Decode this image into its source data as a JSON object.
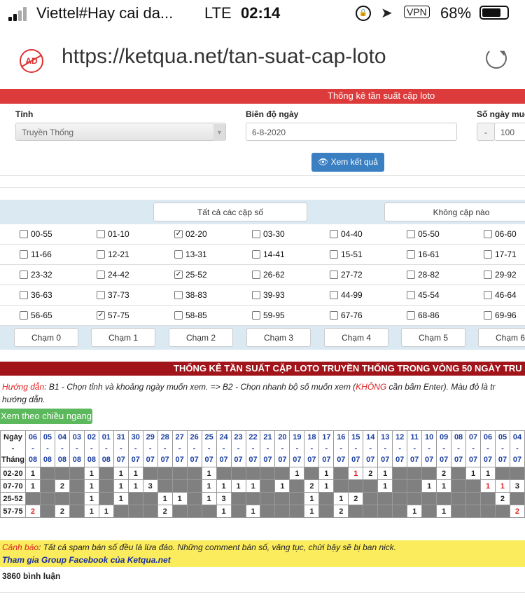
{
  "status_bar": {
    "carrier": "Viettel#Hay cai da...",
    "network": "LTE",
    "time": "02:14",
    "vpn": "VPN",
    "battery": "68%"
  },
  "browser": {
    "ad_badge": "AD",
    "url": "https://ketqua.net/tan-suat-cap-loto"
  },
  "form": {
    "header": "Thống kê tần suất cặp loto",
    "province_label": "Tỉnh",
    "province_value": "Truyền Thống",
    "range_label": "Biên độ ngày",
    "range_value": "6-8-2020",
    "days_label": "Số ngày muốn",
    "days_minus": "-",
    "days_value": "100",
    "submit_label": "Xem kết quả"
  },
  "pairs": {
    "all_label": "Tất cả các cặp số",
    "none_label": "Không cặp nào",
    "rows": [
      [
        {
          "label": "00-55",
          "checked": false
        },
        {
          "label": "01-10",
          "checked": false
        },
        {
          "label": "02-20",
          "checked": true
        },
        {
          "label": "03-30",
          "checked": false
        },
        {
          "label": "04-40",
          "checked": false
        },
        {
          "label": "05-50",
          "checked": false
        },
        {
          "label": "06-60",
          "checked": false
        }
      ],
      [
        {
          "label": "11-66",
          "checked": false
        },
        {
          "label": "12-21",
          "checked": false
        },
        {
          "label": "13-31",
          "checked": false
        },
        {
          "label": "14-41",
          "checked": false
        },
        {
          "label": "15-51",
          "checked": false
        },
        {
          "label": "16-61",
          "checked": false
        },
        {
          "label": "17-71",
          "checked": false
        }
      ],
      [
        {
          "label": "23-32",
          "checked": false
        },
        {
          "label": "24-42",
          "checked": false
        },
        {
          "label": "25-52",
          "checked": true
        },
        {
          "label": "26-62",
          "checked": false
        },
        {
          "label": "27-72",
          "checked": false
        },
        {
          "label": "28-82",
          "checked": false
        },
        {
          "label": "29-92",
          "checked": false
        }
      ],
      [
        {
          "label": "36-63",
          "checked": false
        },
        {
          "label": "37-73",
          "checked": false
        },
        {
          "label": "38-83",
          "checked": false
        },
        {
          "label": "39-93",
          "checked": false
        },
        {
          "label": "44-99",
          "checked": false
        },
        {
          "label": "45-54",
          "checked": false
        },
        {
          "label": "46-64",
          "checked": false
        }
      ],
      [
        {
          "label": "56-65",
          "checked": false
        },
        {
          "label": "57-75",
          "checked": true
        },
        {
          "label": "58-85",
          "checked": false
        },
        {
          "label": "59-95",
          "checked": false
        },
        {
          "label": "67-76",
          "checked": false
        },
        {
          "label": "68-86",
          "checked": false
        },
        {
          "label": "69-96",
          "checked": false
        }
      ]
    ],
    "touch_buttons": [
      "Chạm 0",
      "Chạm 1",
      "Chạm 2",
      "Chạm 3",
      "Chạm 4",
      "Chạm 5",
      "Chạm 6"
    ]
  },
  "stats": {
    "title": "THỐNG KÊ TẦN SUẤT CẶP LOTO TRUYỀN THỐNG TRONG VÒNG 50 NGÀY TRU",
    "guide_label": "Hướng dẫn",
    "guide_text_1": ": B1 - Chọn tỉnh và khoảng ngày muốn xem. => B2 - Chọn nhanh bộ số muốn xem (",
    "guide_emph": "KHÔNG",
    "guide_text_2": " cần bấm Enter). Màu đỏ là tr",
    "guide_text_3": "hướng dẫn.",
    "view_horizontal": "Xem theo chiều ngang",
    "corner_day": "Ngày",
    "corner_sep": "-",
    "corner_month": "Tháng",
    "dates": [
      [
        "06",
        "08"
      ],
      [
        "05",
        "08"
      ],
      [
        "04",
        "08"
      ],
      [
        "03",
        "08"
      ],
      [
        "02",
        "08"
      ],
      [
        "01",
        "08"
      ],
      [
        "31",
        "07"
      ],
      [
        "30",
        "07"
      ],
      [
        "29",
        "07"
      ],
      [
        "28",
        "07"
      ],
      [
        "27",
        "07"
      ],
      [
        "26",
        "07"
      ],
      [
        "25",
        "07"
      ],
      [
        "24",
        "07"
      ],
      [
        "23",
        "07"
      ],
      [
        "22",
        "07"
      ],
      [
        "21",
        "07"
      ],
      [
        "20",
        "07"
      ],
      [
        "19",
        "07"
      ],
      [
        "18",
        "07"
      ],
      [
        "17",
        "07"
      ],
      [
        "16",
        "07"
      ],
      [
        "15",
        "07"
      ],
      [
        "14",
        "07"
      ],
      [
        "13",
        "07"
      ],
      [
        "12",
        "07"
      ],
      [
        "11",
        "07"
      ],
      [
        "10",
        "07"
      ],
      [
        "09",
        "07"
      ],
      [
        "08",
        "07"
      ],
      [
        "07",
        "07"
      ],
      [
        "06",
        "07"
      ],
      [
        "05",
        "07"
      ],
      [
        "04",
        "07"
      ]
    ],
    "rows": [
      {
        "pair": "02-20",
        "cells": [
          "w1",
          "g",
          "g",
          "g",
          "w1",
          "g",
          "w1",
          "w1",
          "g",
          "g",
          "g",
          "g",
          "w1",
          "g",
          "g",
          "g",
          "g",
          "g",
          "w1",
          "g",
          "w1",
          "g",
          "r1",
          "w2",
          "w1",
          "g",
          "g",
          "g",
          "w2",
          "g",
          "w1",
          "w1",
          "g",
          "g"
        ]
      },
      {
        "pair": "07-70",
        "cells": [
          "w1",
          "g",
          "w2",
          "g",
          "w1",
          "g",
          "w1",
          "w1",
          "w3",
          "g",
          "g",
          "g",
          "w1",
          "w1",
          "w1",
          "w1",
          "g",
          "w1",
          "g",
          "w2",
          "w1",
          "g",
          "g",
          "g",
          "w1",
          "g",
          "g",
          "w1",
          "w1",
          "g",
          "g",
          "r1",
          "r1",
          "w3"
        ]
      },
      {
        "pair": "25-52",
        "cells": [
          "g",
          "g",
          "g",
          "g",
          "w1",
          "g",
          "w1",
          "g",
          "g",
          "w1",
          "w1",
          "g",
          "w1",
          "w3",
          "g",
          "g",
          "g",
          "g",
          "g",
          "w1",
          "g",
          "w1",
          "w2",
          "g",
          "g",
          "g",
          "g",
          "g",
          "g",
          "g",
          "g",
          "g",
          "w2",
          "g"
        ]
      },
      {
        "pair": "57-75",
        "cells": [
          "r2",
          "g",
          "w2",
          "g",
          "w1",
          "w1",
          "g",
          "g",
          "g",
          "w2",
          "g",
          "g",
          "g",
          "w1",
          "g",
          "w1",
          "g",
          "g",
          "g",
          "w1",
          "g",
          "w2",
          "g",
          "g",
          "g",
          "g",
          "w1",
          "g",
          "w1",
          "g",
          "g",
          "g",
          "g",
          "r2"
        ]
      }
    ],
    "warning_label": "Cảnh báo",
    "warning_text": ": Tất cả spam bán số đều là lừa đảo. Những comment bán số, văng tục, chửi bậy sẽ bị ban nick.",
    "facebook_link": "Tham gia Group Facebook của Ketqua.net",
    "comments": "3860 bình luận"
  },
  "colors": {
    "red_header": "#dd3b3b",
    "dark_red": "#a0141a",
    "blue_button": "#3a7fc1",
    "green_button": "#5cb85c",
    "warning_bg": "#fbec5d",
    "panel_bg": "#dbe9f3"
  }
}
